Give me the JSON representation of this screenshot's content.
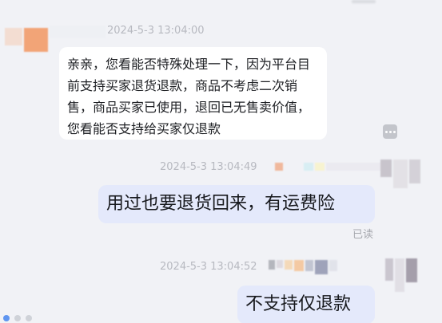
{
  "messages": [
    {
      "direction": "incoming",
      "timestamp": "2024-5-3 13:04:00",
      "text": "亲亲，您看能否特殊处理一下，因为平台目前支持买家退货退款，商品不考虑二次销售，商品买家已使用，退回已无售卖价值，您看能否支持给买家仅退款"
    },
    {
      "direction": "outgoing",
      "timestamp": "2024-5-3 13:04:49",
      "text": "用过也要退货回来，有运费险",
      "status": "已读"
    },
    {
      "direction": "outgoing",
      "timestamp": "2024-5-3 13:04:52",
      "text": "不支持仅退款"
    }
  ],
  "icons": {
    "more": "more-options-icon",
    "typing": "typing-indicator-icon"
  },
  "colors": {
    "background": "#f1f2f6",
    "incoming_bubble": "#ffffff",
    "outgoing_bubble": "#e4e9fb",
    "timestamp": "#b7b9c0"
  }
}
